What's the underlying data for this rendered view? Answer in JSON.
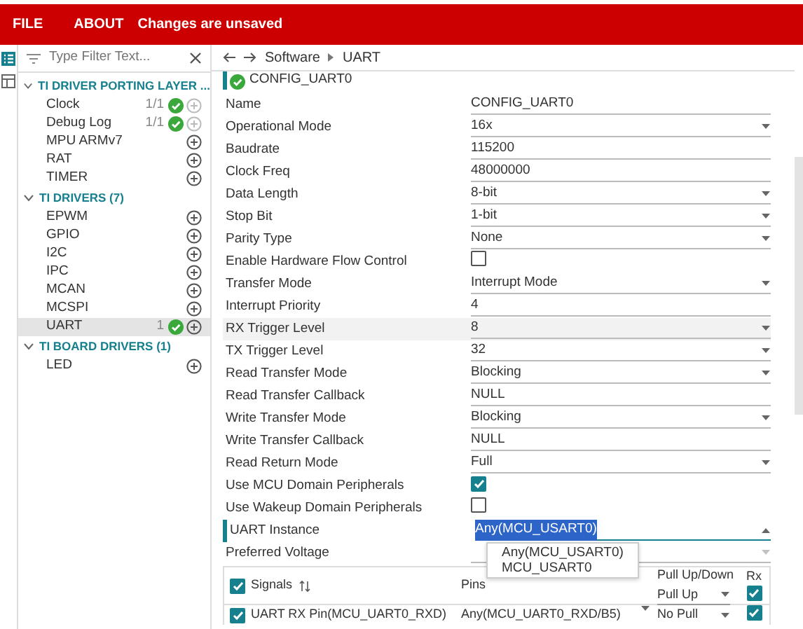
{
  "menu": [
    {
      "label": "FILE"
    },
    {
      "label": "ABOUT"
    }
  ],
  "status": "Changes are unsaved",
  "filter": {
    "placeholder": "Type Filter Text..."
  },
  "groups": [
    {
      "title": "TI DRIVER PORTING LAYER ...",
      "expanded": true,
      "items": [
        {
          "label": "Clock",
          "count": "1/1",
          "ok": true,
          "add_enabled": false,
          "selected": false
        },
        {
          "label": "Debug Log",
          "count": "1/1",
          "ok": true,
          "add_enabled": false,
          "selected": false
        },
        {
          "label": "MPU ARMv7",
          "ok": false,
          "add_enabled": true,
          "selected": false
        },
        {
          "label": "RAT",
          "ok": false,
          "add_enabled": true,
          "selected": false
        },
        {
          "label": "TIMER",
          "ok": false,
          "add_enabled": true,
          "selected": false
        }
      ]
    },
    {
      "title": "TI DRIVERS (7)",
      "expanded": true,
      "items": [
        {
          "label": "EPWM",
          "ok": false,
          "add_enabled": true,
          "selected": false
        },
        {
          "label": "GPIO",
          "ok": false,
          "add_enabled": true,
          "selected": false
        },
        {
          "label": "I2C",
          "ok": false,
          "add_enabled": true,
          "selected": false
        },
        {
          "label": "IPC",
          "ok": false,
          "add_enabled": true,
          "selected": false
        },
        {
          "label": "MCAN",
          "ok": false,
          "add_enabled": true,
          "selected": false
        },
        {
          "label": "MCSPI",
          "ok": false,
          "add_enabled": true,
          "selected": false
        },
        {
          "label": "UART",
          "count": "1",
          "ok": true,
          "add_enabled": true,
          "selected": true
        }
      ]
    },
    {
      "title": "TI BOARD DRIVERS (1)",
      "expanded": true,
      "items": [
        {
          "label": "LED",
          "ok": false,
          "add_enabled": true,
          "selected": false
        }
      ]
    }
  ],
  "breadcrumb": [
    "Software",
    "UART"
  ],
  "instance_title": "CONFIG_UART0",
  "fields": [
    {
      "kind": "text",
      "label": "Name",
      "value": "CONFIG_UART0",
      "selected": false
    },
    {
      "kind": "select",
      "label": "Operational Mode",
      "value": "16x",
      "selected": false
    },
    {
      "kind": "text",
      "label": "Baudrate",
      "value": "115200",
      "selected": false
    },
    {
      "kind": "text",
      "label": "Clock Freq",
      "value": "48000000",
      "selected": false
    },
    {
      "kind": "select",
      "label": "Data Length",
      "value": "8-bit",
      "selected": false
    },
    {
      "kind": "select",
      "label": "Stop Bit",
      "value": "1-bit",
      "selected": false
    },
    {
      "kind": "select",
      "label": "Parity Type",
      "value": "None",
      "selected": false
    },
    {
      "kind": "checkbox",
      "label": "Enable Hardware Flow Control",
      "checked": false,
      "selected": false
    },
    {
      "kind": "select",
      "label": "Transfer Mode",
      "value": "Interrupt Mode",
      "selected": false
    },
    {
      "kind": "text",
      "label": "Interrupt Priority",
      "value": "4",
      "selected": false
    },
    {
      "kind": "select",
      "label": "RX Trigger Level",
      "value": "8",
      "selected": true
    },
    {
      "kind": "select",
      "label": "TX Trigger Level",
      "value": "32",
      "selected": false
    },
    {
      "kind": "select",
      "label": "Read Transfer Mode",
      "value": "Blocking",
      "selected": false
    },
    {
      "kind": "text",
      "label": "Read Transfer Callback",
      "value": "NULL",
      "selected": false
    },
    {
      "kind": "select",
      "label": "Write Transfer Mode",
      "value": "Blocking",
      "selected": false
    },
    {
      "kind": "text",
      "label": "Write Transfer Callback",
      "value": "NULL",
      "selected": false
    },
    {
      "kind": "select",
      "label": "Read Return Mode",
      "value": "Full",
      "selected": false
    },
    {
      "kind": "checkbox",
      "label": "Use MCU Domain Peripherals",
      "checked": true,
      "selected": false
    },
    {
      "kind": "checkbox",
      "label": "Use Wakeup Domain Peripherals",
      "checked": false,
      "selected": false
    },
    {
      "kind": "open-select",
      "label": "UART Instance",
      "value": "Any(MCU_USART0)",
      "selected": false,
      "options": [
        "Any(MCU_USART0)",
        "MCU_USART0"
      ]
    },
    {
      "kind": "select",
      "label": "Preferred Voltage",
      "selected": false
    }
  ],
  "signals": {
    "header": {
      "label": "Signals",
      "checked": true,
      "pins": "Pins",
      "pull": "Pull Up/Down",
      "pull_value": "Pull Up",
      "rx": "Rx",
      "rx_checked": true
    },
    "rows": [
      {
        "label": "UART RX Pin(MCU_UART0_RXD)",
        "checked": true,
        "pin": "Any(MCU_UART0_RXD/B5)",
        "pull": "No Pull",
        "rx_checked": true
      }
    ]
  }
}
